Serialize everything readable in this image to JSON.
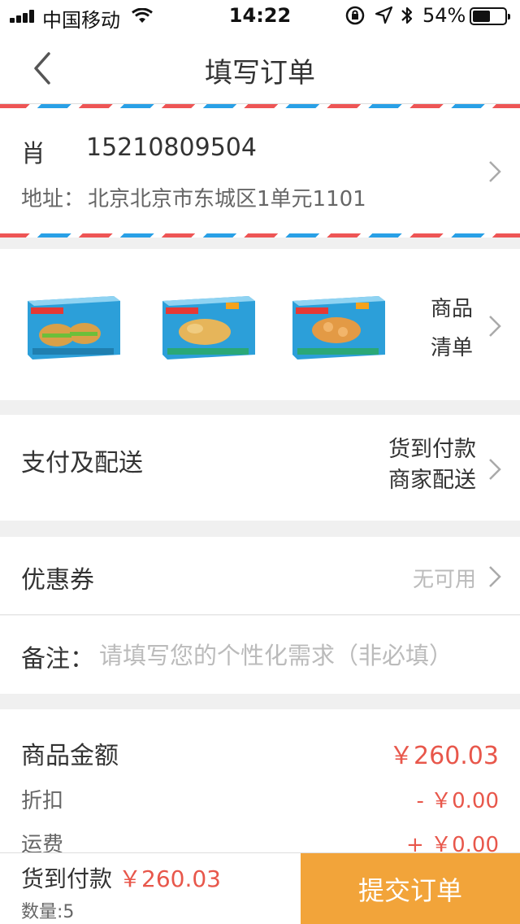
{
  "status_bar": {
    "carrier": "中国移动",
    "time": "14:22",
    "battery_percent": "54%",
    "battery_level": 0.54,
    "icons": [
      "signal-icon",
      "wifi-icon",
      "rotation-lock-icon",
      "location-icon",
      "bluetooth-icon",
      "battery-icon"
    ]
  },
  "nav": {
    "title": "填写订单",
    "back_icon": "back-chevron-icon"
  },
  "address": {
    "name": "肖",
    "phone": "15210809504",
    "address_label": "地址：",
    "address_value": "北京北京市东城区1单元1101"
  },
  "products": {
    "items": [
      {
        "name": "product-burger-box"
      },
      {
        "name": "product-fish-box"
      },
      {
        "name": "product-shrimp-box"
      }
    ],
    "list_label_line1": "商品",
    "list_label_line2": "清单"
  },
  "payment": {
    "label": "支付及配送",
    "method": "货到付款",
    "delivery": "商家配送"
  },
  "coupon": {
    "label": "优惠券",
    "value": "无可用"
  },
  "remark": {
    "label": "备注：",
    "placeholder": "请填写您的个性化需求（非必填）"
  },
  "summary": {
    "goods_amount_label": "商品金额",
    "goods_amount_value": "￥260.03",
    "discount_label": "折扣",
    "discount_value": "- ￥0.00",
    "shipping_label": "运费",
    "shipping_value": "+ ￥0.00"
  },
  "bottom": {
    "pay_label": "货到付款",
    "total": "￥260.03",
    "quantity": "数量:5",
    "submit_label": "提交订单"
  },
  "colors": {
    "accent": "#f2a43a",
    "price": "#e8574b",
    "airmail_red": "#e55555",
    "airmail_blue": "#29a0e6"
  }
}
